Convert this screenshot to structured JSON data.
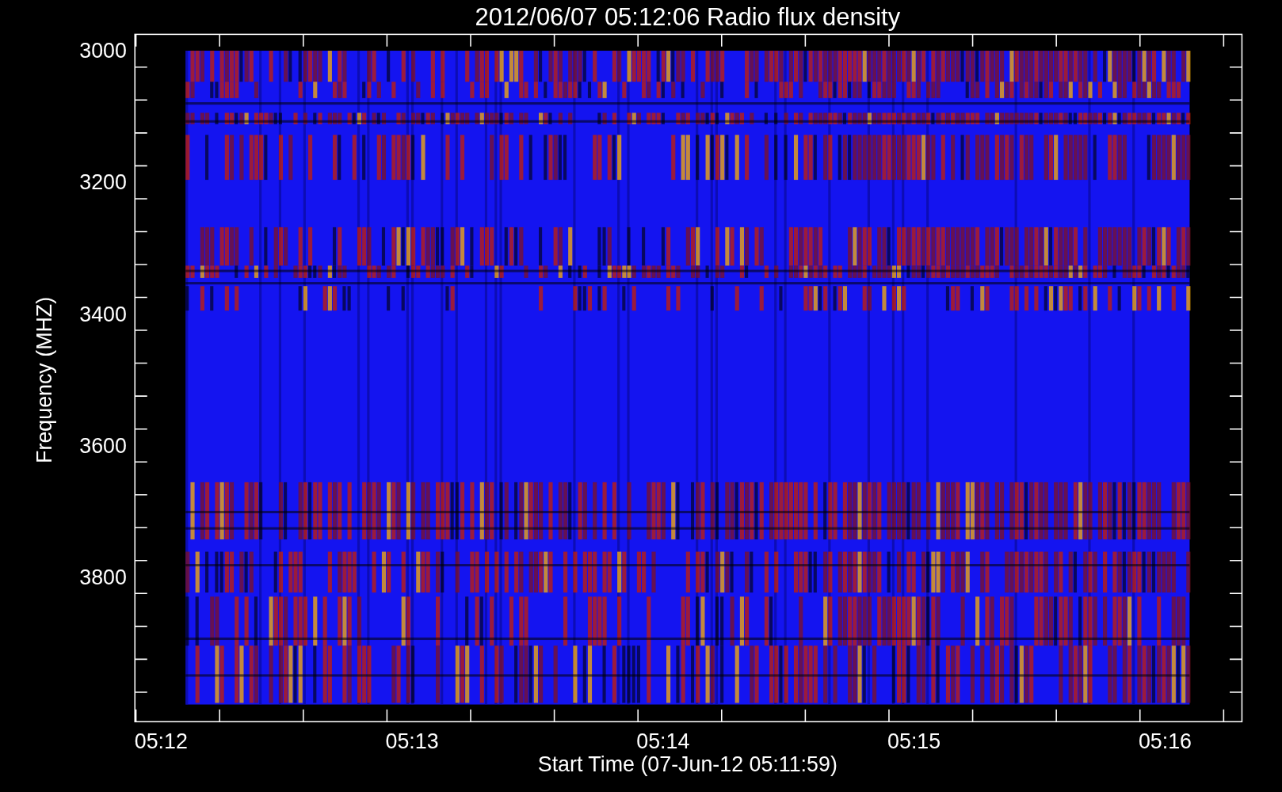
{
  "plot": {
    "title": "2012/06/07 05:12:06 Radio flux density",
    "y_axis": {
      "label": "Frequency (MHZ)",
      "ticks": [
        "3000",
        "3200",
        "3400",
        "3600",
        "3800"
      ]
    },
    "x_axis": {
      "label": "Start Time (07-Jun-12 05:11:59)",
      "ticks": [
        "05:12",
        "05:13",
        "05:14",
        "05:15",
        "05:16"
      ]
    }
  }
}
